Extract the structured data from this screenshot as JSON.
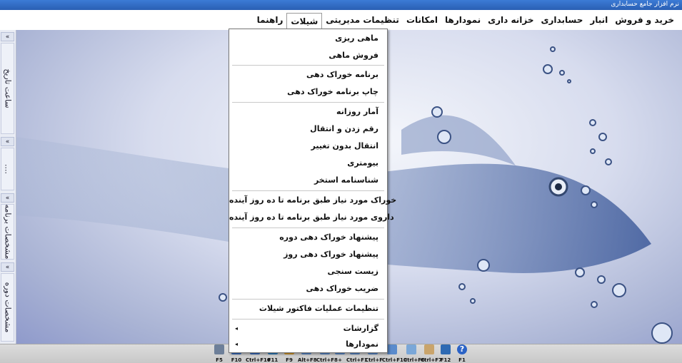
{
  "window": {
    "title": "نرم افزار جامع حسابداری"
  },
  "menubar": {
    "items": [
      {
        "label": "خرید و فروش"
      },
      {
        "label": "انبار"
      },
      {
        "label": "حسابداری"
      },
      {
        "label": "خزانه داری"
      },
      {
        "label": "نمودارها"
      },
      {
        "label": "امکانات"
      },
      {
        "label": "تنظیمات مدیریتی"
      },
      {
        "label": "شیلات"
      },
      {
        "label": "راهنما"
      }
    ],
    "active": "شیلات"
  },
  "sidebar": {
    "collapse_glyph": "«",
    "panels": [
      {
        "label": "ساعت تاریخ"
      },
      {
        "label": "...."
      },
      {
        "label": "مشخصات برنامه"
      },
      {
        "label": "مشخصات دوره"
      }
    ]
  },
  "dropdown": {
    "items": [
      {
        "label": "ماهی ریزی"
      },
      {
        "label": "فروش ماهی"
      },
      {
        "label": "برنامه خوراک دهی"
      },
      {
        "label": "چاپ برنامه خوراک دهی"
      },
      {
        "label": "آمار روزانه"
      },
      {
        "label": "رقم زدن و انتقال"
      },
      {
        "label": "انتقال بدون تغییر"
      },
      {
        "label": "بیومتری"
      },
      {
        "label": "شناسنامه استخر"
      },
      {
        "label": "خوراک مورد نیاز طبق برنامه تا ده روز آینده"
      },
      {
        "label": "داروی مورد نیاز طبق برنامه تا ده روز آینده"
      },
      {
        "label": "پیشنهاد خوراک دهی دوره"
      },
      {
        "label": "پیشنهاد خوراک دهی روز"
      },
      {
        "label": "زیست سنجی"
      },
      {
        "label": "ضریب خوراک دهی"
      },
      {
        "label": "تنظیمات عملیات فاکتور شیلات"
      },
      {
        "label": "گزارشات",
        "submenu": true
      },
      {
        "label": "نمودارها",
        "submenu": true
      }
    ],
    "submenu_glyph": "◂"
  },
  "taskbar": {
    "buttons": [
      {
        "label": "F5",
        "icon": "calculator-icon",
        "color": "#6d7f99"
      },
      {
        "label": "F10",
        "icon": "app-icon",
        "color": "#3b6fc2"
      },
      {
        "label": "Ctrl+F10",
        "icon": "app-icon",
        "color": "#3b6fc2"
      },
      {
        "label": "F11",
        "icon": "app-icon",
        "color": "#2f7fbf"
      },
      {
        "label": "F9",
        "icon": "pencil-icon",
        "color": "#d79a2b"
      },
      {
        "label": "Alt+F8",
        "icon": "app-icon",
        "color": "#5a8bcc"
      },
      {
        "label": "Ctrl+F8",
        "icon": "app-icon",
        "color": "#5a8bcc"
      },
      {
        "label": "+",
        "icon": "app-icon",
        "color": "#5a8bcc"
      },
      {
        "label": "Ctrl+F1",
        "icon": "app-icon",
        "color": "#5a8bcc"
      },
      {
        "label": "Ctrl+F",
        "icon": "app-icon",
        "color": "#5a8bcc"
      },
      {
        "label": "Ctrl+F10",
        "icon": "app-icon",
        "color": "#5a8bcc"
      },
      {
        "label": "Ctrl+F6",
        "icon": "brush-icon",
        "color": "#7aa7d8"
      },
      {
        "label": "Ctrl+F7",
        "icon": "money-icon",
        "color": "#c9a46b"
      },
      {
        "label": "F12",
        "icon": "monitor-icon",
        "color": "#2e6ab3"
      },
      {
        "label": "F1",
        "icon": "help-icon",
        "color": "#2b63c6"
      }
    ]
  },
  "colors": {
    "accent": "#2a5fb3",
    "desktop": "#a9b3d4"
  }
}
